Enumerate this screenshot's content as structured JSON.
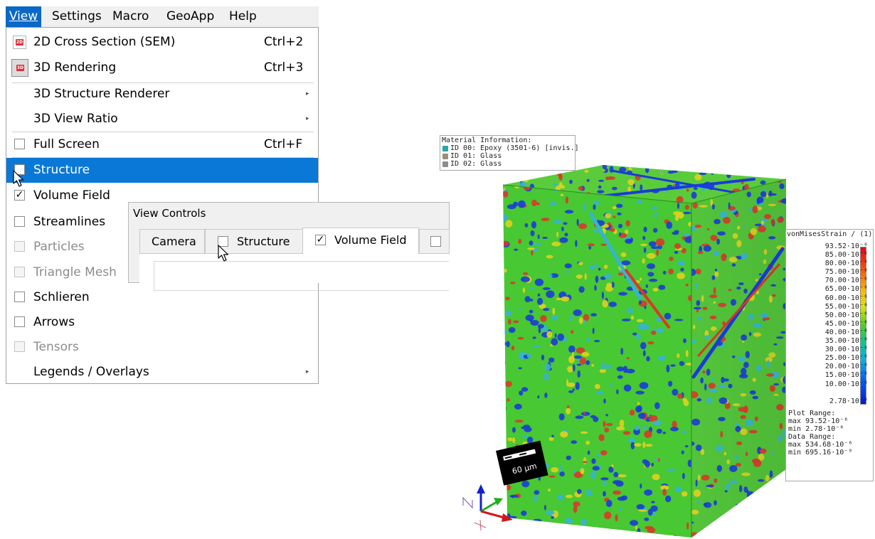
{
  "menubar": {
    "items": [
      {
        "label": "View",
        "active": true
      },
      {
        "label": "Settings"
      },
      {
        "label": "Macro"
      },
      {
        "label": "GeoApp"
      },
      {
        "label": "Help"
      }
    ]
  },
  "view_menu": {
    "items": [
      {
        "label": "2D Cross Section (SEM)",
        "shortcut": "Ctrl+2",
        "icon": "2d-icon",
        "icon_text": "2D"
      },
      {
        "label": "3D Rendering",
        "shortcut": "Ctrl+3",
        "icon": "3d-icon",
        "icon_text": "3D"
      },
      {
        "label": "3D Structure Renderer",
        "submenu": true
      },
      {
        "label": "3D View Ratio",
        "submenu": true
      },
      {
        "label": "Full Screen",
        "shortcut": "Ctrl+F",
        "checked": false
      },
      {
        "label": "Structure",
        "checked": false,
        "highlighted": true
      },
      {
        "label": "Volume Field",
        "checked": true
      },
      {
        "label": "Streamlines",
        "checked": false
      },
      {
        "label": "Particles",
        "checked": false,
        "disabled": true
      },
      {
        "label": "Triangle Mesh",
        "checked": false,
        "disabled": true
      },
      {
        "label": "Schlieren",
        "checked": false
      },
      {
        "label": "Arrows",
        "checked": false
      },
      {
        "label": "Tensors",
        "checked": false,
        "disabled": true
      },
      {
        "label": "Legends / Overlays",
        "submenu": true
      }
    ],
    "check_mark": "✓",
    "submenu_arrow": "▸"
  },
  "view_controls": {
    "title": "View Controls",
    "tabs": [
      {
        "label": "Camera"
      },
      {
        "label": "Structure",
        "checked": false
      },
      {
        "label": "Volume Field",
        "checked": true,
        "active": true
      },
      {
        "label": "",
        "checked": false
      }
    ]
  },
  "material_info": {
    "title": "Material Information:",
    "items": [
      {
        "text": "ID 00: Epoxy (3501-6) [invis.]",
        "color": "#2aa5a8"
      },
      {
        "text": "ID 01: Glass",
        "color": "#9a8f78"
      },
      {
        "text": "ID 02: Glass",
        "color": "#8c8c8c"
      }
    ]
  },
  "legend": {
    "title": "vonMisesStrain / (1)",
    "colors": [
      "#e8001e",
      "#ffb400",
      "#4ad21e",
      "#00b4e6",
      "#0018d2"
    ],
    "ticks": [
      "93.52·10⁻⁶",
      "85.00·10⁻⁶",
      "80.00·10⁻⁶",
      "75.00·10⁻⁶",
      "70.00·10⁻⁶",
      "65.00·10⁻⁶",
      "60.00·10⁻⁶",
      "55.00·10⁻⁶",
      "50.00·10⁻⁶",
      "45.00·10⁻⁶",
      "40.00·10⁻⁶",
      "35.00·10⁻⁶",
      "30.00·10⁻⁶",
      "25.00·10⁻⁶",
      "20.00·10⁻⁶",
      "15.00·10⁻⁶",
      "10.00·10⁻⁶",
      "2.78·10⁻⁶"
    ],
    "plot_range_label": "Plot Range:",
    "plot_max": "max    93.52·10⁻⁶",
    "plot_min": "min     2.78·10⁻⁶",
    "data_range_label": "Data Range:",
    "data_max": "max  534.68·10⁻⁶",
    "data_min": "min  695.16·10⁻⁹"
  },
  "scalebar": {
    "label": "60 μm"
  },
  "cube_colors": [
    "#48c832",
    "#e0d020",
    "#1a3cd8",
    "#d83a28",
    "#36b4d2"
  ]
}
